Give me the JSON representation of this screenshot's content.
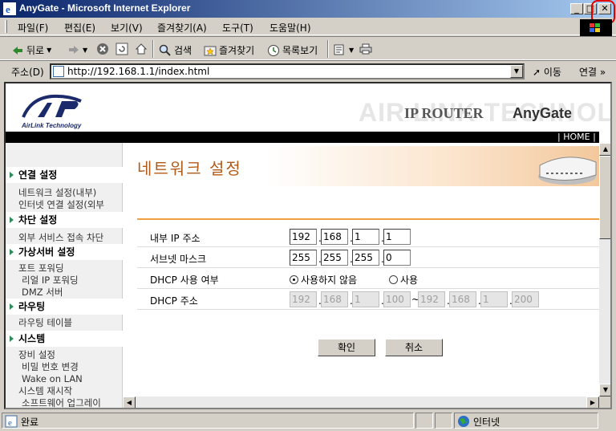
{
  "window": {
    "title": "AnyGate - Microsoft Internet Explorer",
    "min_label": "_",
    "max_label": "□",
    "close_label": "✕"
  },
  "menu": {
    "items": [
      "파일(F)",
      "편집(E)",
      "보기(V)",
      "즐겨찾기(A)",
      "도구(T)",
      "도움말(H)"
    ]
  },
  "toolbar": {
    "back": "뒤로",
    "search": "검색",
    "favorites": "즐겨찾기",
    "history": "목록보기"
  },
  "address": {
    "label": "주소(D)",
    "url": "http://192.168.1.1/index.html",
    "go": "이동",
    "links": "연결 »"
  },
  "header": {
    "brand_logo_text": "AirLink Technology",
    "bg_text": "AIR LINK TECHNOLOGY",
    "product_type": "IP ROUTER",
    "product_name": "AnyGate",
    "nav_text": "| HOME | MA"
  },
  "sidebar": {
    "sections": [
      {
        "title": "연결 설정",
        "items": [
          "네트워크 설정(내부)",
          "인터넷 연결 설정(외부"
        ]
      },
      {
        "title": "차단 설정",
        "items": [
          "외부 서비스 접속 차단"
        ]
      },
      {
        "title": "가상서버 설정",
        "items": [
          "포트 포워딩",
          "리얼 IP 포워딩",
          "DMZ 서버"
        ]
      },
      {
        "title": "라우팅",
        "items": [
          "라우팅 테이블"
        ]
      },
      {
        "title": "시스템",
        "items": [
          "장비 설정",
          "비밀 번호 변경",
          "Wake on LAN",
          "시스템 재시작",
          "소프트웨어 업그레이"
        ]
      }
    ]
  },
  "page": {
    "title": "네트워크 설정"
  },
  "form": {
    "internal_ip": {
      "label": "내부 IP 주소",
      "octets": [
        "192",
        "168",
        "1",
        "1"
      ]
    },
    "subnet": {
      "label": "서브넷 마스크",
      "octets": [
        "255",
        "255",
        "255",
        "0"
      ]
    },
    "dhcp_use": {
      "label": "DHCP 사용 여부",
      "option_off": "사용하지 않음",
      "option_on": "사용",
      "selected": "off"
    },
    "dhcp_range": {
      "label": "DHCP 주소",
      "start": [
        "192",
        "168",
        "1",
        "100"
      ],
      "separator": "~",
      "end": [
        "192",
        "168",
        "1",
        "200"
      ]
    },
    "dot": "."
  },
  "buttons": {
    "confirm": "확인",
    "cancel": "취소"
  },
  "status": {
    "text": "완료",
    "zone": "인터넷"
  }
}
